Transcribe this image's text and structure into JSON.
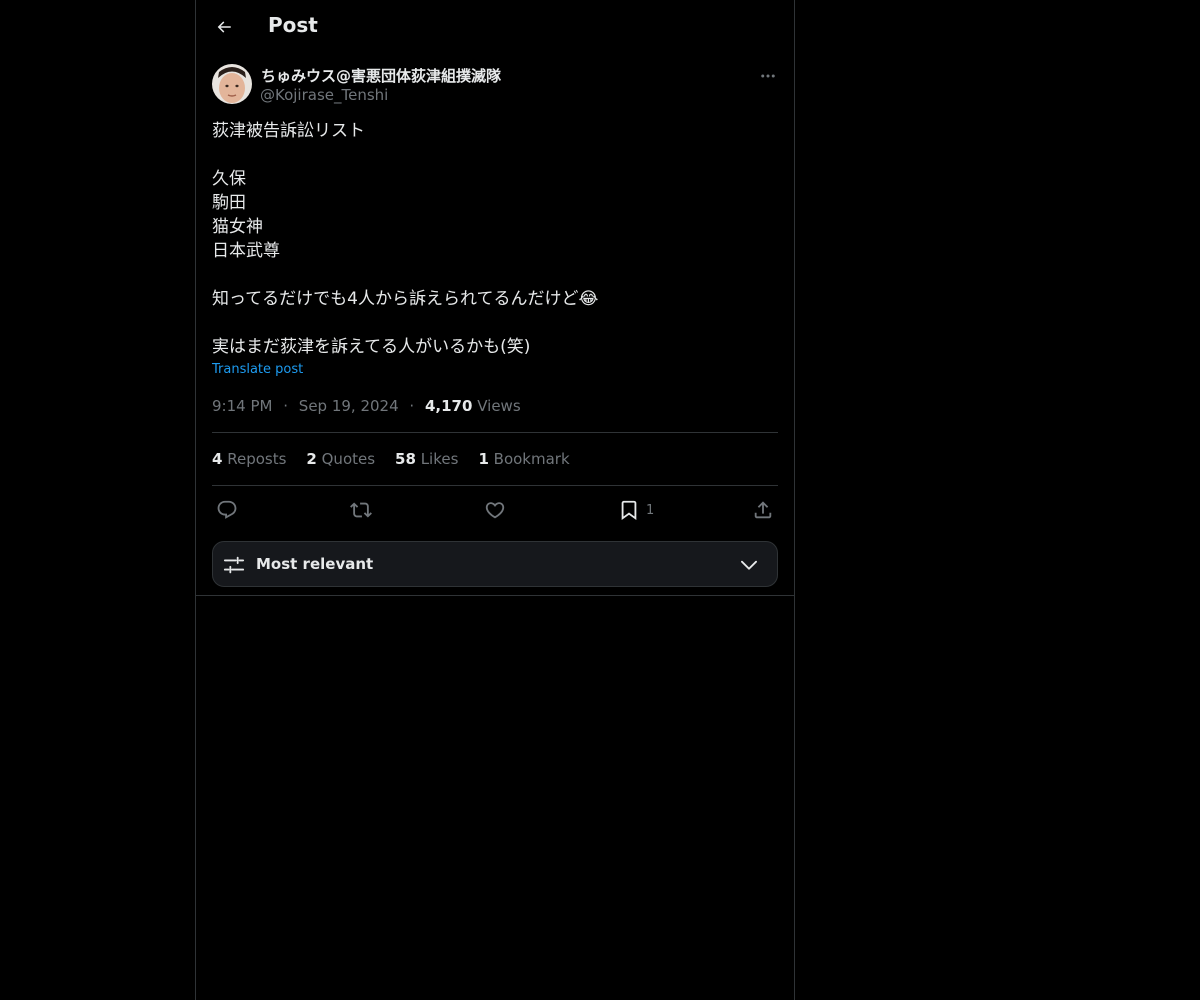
{
  "header": {
    "title": "Post",
    "back_icon": "arrow-left-icon"
  },
  "author": {
    "name": "ちゅみウス@害悪団体荻津組撲滅隊",
    "handle": "@Kojirase_Tenshi",
    "avatar_icon": "user-avatar",
    "more_icon": "more-dots-icon"
  },
  "post": {
    "lines": [
      "荻津被告訴訟リスト",
      "",
      "久保",
      "駒田",
      "猫女神",
      "日本武尊",
      "",
      "知ってるだけでも4人から訴えられてるんだけど",
      "",
      "実はまだ荻津を訴えてる人がいるかも(笑)"
    ],
    "emoji": "😂",
    "translate_label": "Translate post"
  },
  "meta": {
    "time": "9:14 PM",
    "date": "Sep 19, 2024",
    "separator": "·",
    "views_count": "4,170",
    "views_label": "Views"
  },
  "stats": {
    "reposts_count": "4",
    "reposts_label": "Reposts",
    "quotes_count": "2",
    "quotes_label": "Quotes",
    "likes_count": "58",
    "likes_label": "Likes",
    "bookmarks_count": "1",
    "bookmarks_label": "Bookmark"
  },
  "actions": {
    "reply_icon": "reply-icon",
    "repost_icon": "repost-icon",
    "like_icon": "heart-icon",
    "bookmark_icon": "bookmark-icon",
    "bookmark_count": "1",
    "share_icon": "share-icon"
  },
  "sort": {
    "label": "Most relevant",
    "filter_icon": "sliders-icon",
    "chevron_icon": "chevron-down-icon"
  },
  "colors": {
    "background": "#000000",
    "text": "#e7e9ea",
    "secondary": "#71767b",
    "accent": "#1d9bf0",
    "border": "#2f3336"
  }
}
